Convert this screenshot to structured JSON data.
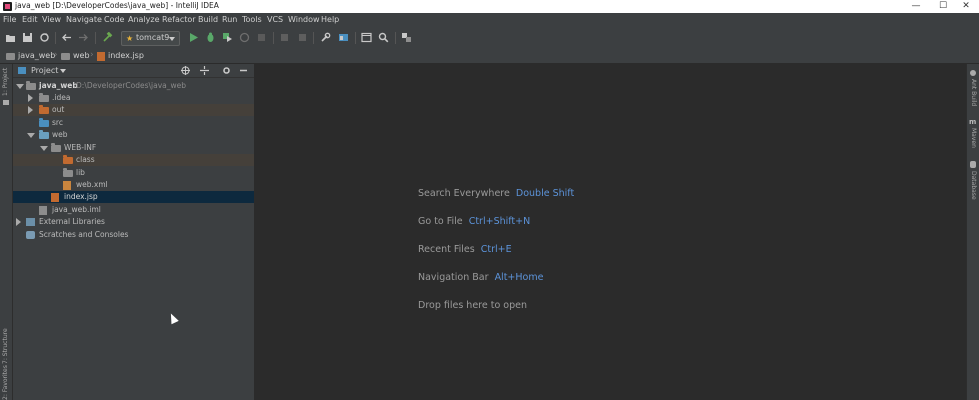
{
  "window": {
    "title": "java_web [D:\\DeveloperCodes\\java_web] - IntelliJ IDEA",
    "controls": {
      "minimize": "—",
      "maximize": "☐",
      "close": "✕"
    }
  },
  "menu": [
    "File",
    "Edit",
    "View",
    "Navigate",
    "Code",
    "Analyze",
    "Refactor",
    "Build",
    "Run",
    "Tools",
    "VCS",
    "Window",
    "Help"
  ],
  "toolbar": {
    "run_config": "tomcat9"
  },
  "breadcrumbs": [
    "java_web",
    "web",
    "index.jsp"
  ],
  "left_strip": {
    "project_tab": "1: Project",
    "structure_tab": "7: Structure",
    "favorites_tab": "2: Favorites"
  },
  "right_strip": {
    "ant": "Ant Build",
    "maven": "Maven",
    "database": "Database"
  },
  "project_panel": {
    "title": "Project",
    "tree": [
      {
        "label": "java_web",
        "path": "D:\\DeveloperCodes\\java_web"
      },
      {
        "label": ".idea"
      },
      {
        "label": "out"
      },
      {
        "label": "src"
      },
      {
        "label": "web"
      },
      {
        "label": "WEB-INF"
      },
      {
        "label": "class"
      },
      {
        "label": "lib"
      },
      {
        "label": "web.xml"
      },
      {
        "label": "index.jsp"
      },
      {
        "label": "java_web.iml"
      },
      {
        "label": "External Libraries"
      },
      {
        "label": "Scratches and Consoles"
      }
    ]
  },
  "editor": {
    "hints": [
      {
        "text": "Search Everywhere",
        "key": "Double Shift"
      },
      {
        "text": "Go to File",
        "key": "Ctrl+Shift+N"
      },
      {
        "text": "Recent Files",
        "key": "Ctrl+E"
      },
      {
        "text": "Navigation Bar",
        "key": "Alt+Home"
      },
      {
        "text": "Drop files here to open",
        "key": ""
      }
    ]
  },
  "colors": {
    "accent_blue": "#5c93d9",
    "excluded_folder": "#c26a30",
    "source_folder": "#4a8fbf",
    "selection": "#0d293e"
  }
}
